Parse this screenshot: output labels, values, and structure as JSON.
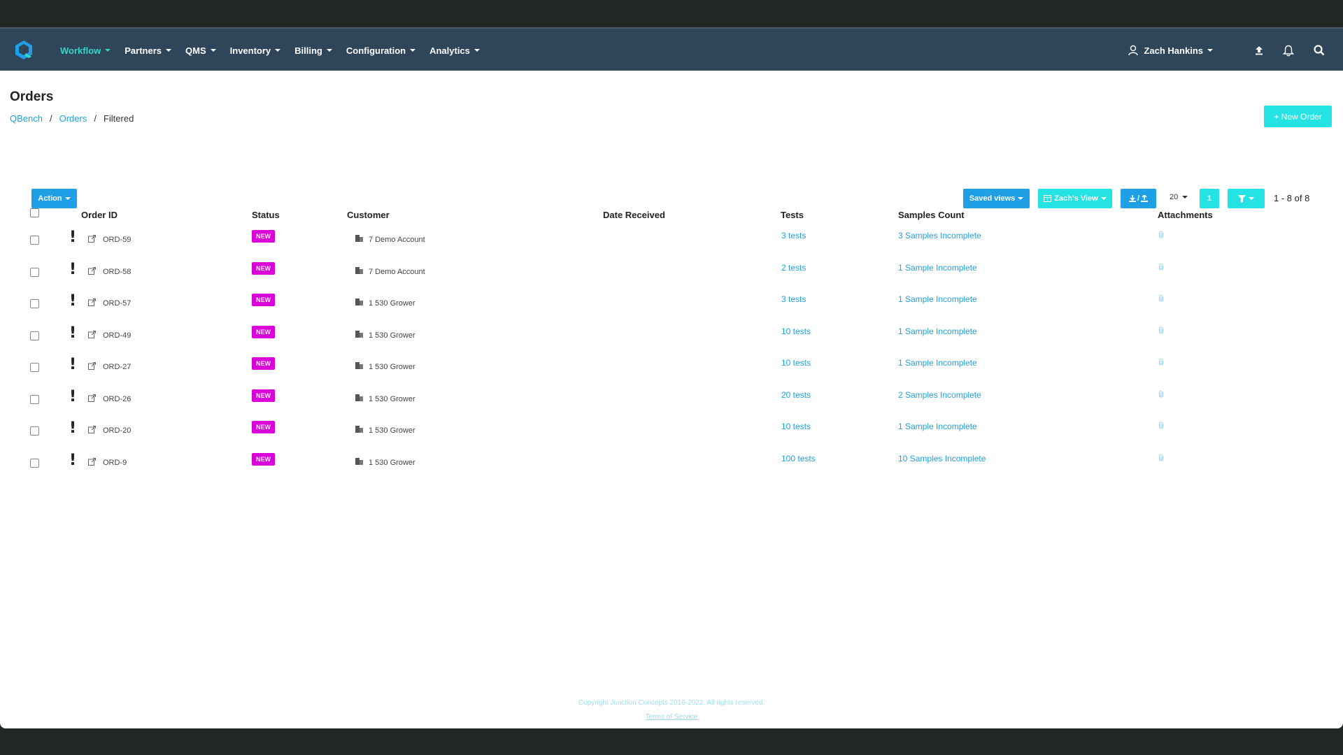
{
  "nav": {
    "items": [
      {
        "label": "Workflow",
        "active": true
      },
      {
        "label": "Partners"
      },
      {
        "label": "QMS"
      },
      {
        "label": "Inventory"
      },
      {
        "label": "Billing"
      },
      {
        "label": "Configuration"
      },
      {
        "label": "Analytics"
      }
    ],
    "user": "Zach Hankins",
    "icons": [
      "user-icon",
      "upload-icon",
      "bell-icon",
      "search-icon"
    ]
  },
  "header": {
    "title": "Orders",
    "breadcrumb": [
      "QBench",
      "Orders",
      "Filtered"
    ],
    "new_order": "+ New Order"
  },
  "toolbar": {
    "action": "Action",
    "saved_views": "Saved views",
    "view": "Zach's View",
    "export": "/",
    "per_page": "20",
    "page": "1",
    "count": "1 - 8 of 8"
  },
  "table": {
    "columns": [
      "Order ID",
      "Status",
      "Customer",
      "Date Received",
      "Tests",
      "Samples Count",
      "Attachments"
    ],
    "rows": [
      {
        "id": "ORD-59",
        "status": "NEW",
        "customer": "7  Demo Account",
        "date": "",
        "tests": "3 tests",
        "samples": "3 Samples Incomplete"
      },
      {
        "id": "ORD-58",
        "status": "NEW",
        "customer": "7  Demo Account",
        "date": "",
        "tests": "2 tests",
        "samples": "1 Sample Incomplete"
      },
      {
        "id": "ORD-57",
        "status": "NEW",
        "customer": "1  530 Grower",
        "date": "",
        "tests": "3 tests",
        "samples": "1 Sample Incomplete"
      },
      {
        "id": "ORD-49",
        "status": "NEW",
        "customer": "1  530 Grower",
        "date": "",
        "tests": "10 tests",
        "samples": "1 Sample Incomplete"
      },
      {
        "id": "ORD-27",
        "status": "NEW",
        "customer": "1  530 Grower",
        "date": "",
        "tests": "10 tests",
        "samples": "1 Sample Incomplete"
      },
      {
        "id": "ORD-26",
        "status": "NEW",
        "customer": "1  530 Grower",
        "date": "",
        "tests": "20 tests",
        "samples": "2 Samples Incomplete"
      },
      {
        "id": "ORD-20",
        "status": "NEW",
        "customer": "1  530 Grower",
        "date": "",
        "tests": "10 tests",
        "samples": "1 Sample Incomplete"
      },
      {
        "id": "ORD-9",
        "status": "NEW",
        "customer": "1  530 Grower",
        "date": "",
        "tests": "100 tests",
        "samples": "10 Samples Incomplete"
      }
    ]
  },
  "footer": {
    "copyright": "Copyright Junction Concepts 2016-2022. All rights reserved.",
    "terms": "Terms of Service"
  },
  "colors": {
    "nav_bg": "#2f4559",
    "active": "#35d6c8",
    "primary": "#1e9fe6",
    "accent": "#25e3e3",
    "badge": "#d900d9",
    "link": "#1da1e0"
  }
}
